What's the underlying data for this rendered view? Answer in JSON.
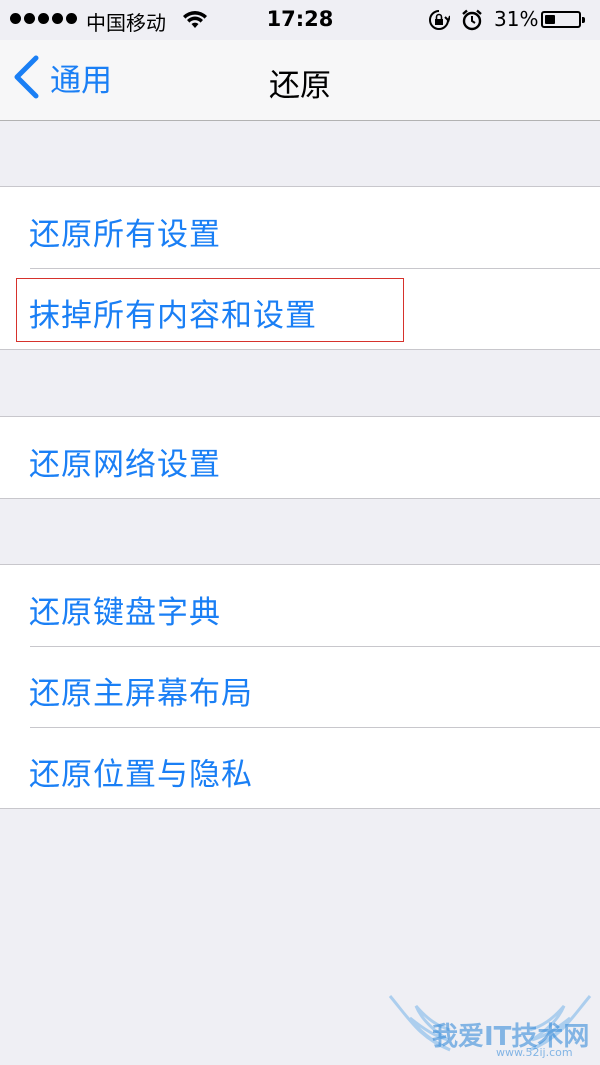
{
  "status_bar": {
    "carrier": "中国移动",
    "time": "17:28",
    "battery_percent": "31%",
    "battery_level": 0.31,
    "icons": [
      "signal-dots-icon",
      "wifi-icon",
      "rotation-lock-icon",
      "alarm-icon",
      "battery-icon"
    ]
  },
  "nav": {
    "back_label": "通用",
    "title": "还原"
  },
  "groups": [
    {
      "items": [
        {
          "label": "还原所有设置"
        },
        {
          "label": "抹掉所有内容和设置",
          "highlighted": true
        }
      ]
    },
    {
      "items": [
        {
          "label": "还原网络设置"
        }
      ]
    },
    {
      "items": [
        {
          "label": "还原键盘字典"
        },
        {
          "label": "还原主屏幕布局"
        },
        {
          "label": "还原位置与隐私"
        }
      ]
    }
  ],
  "watermark": {
    "text": "我爱IT技术网",
    "url": "www.52ij.com"
  },
  "colors": {
    "accent": "#1a7ff5",
    "background": "#efeff4",
    "highlight_border": "#d6322c"
  }
}
